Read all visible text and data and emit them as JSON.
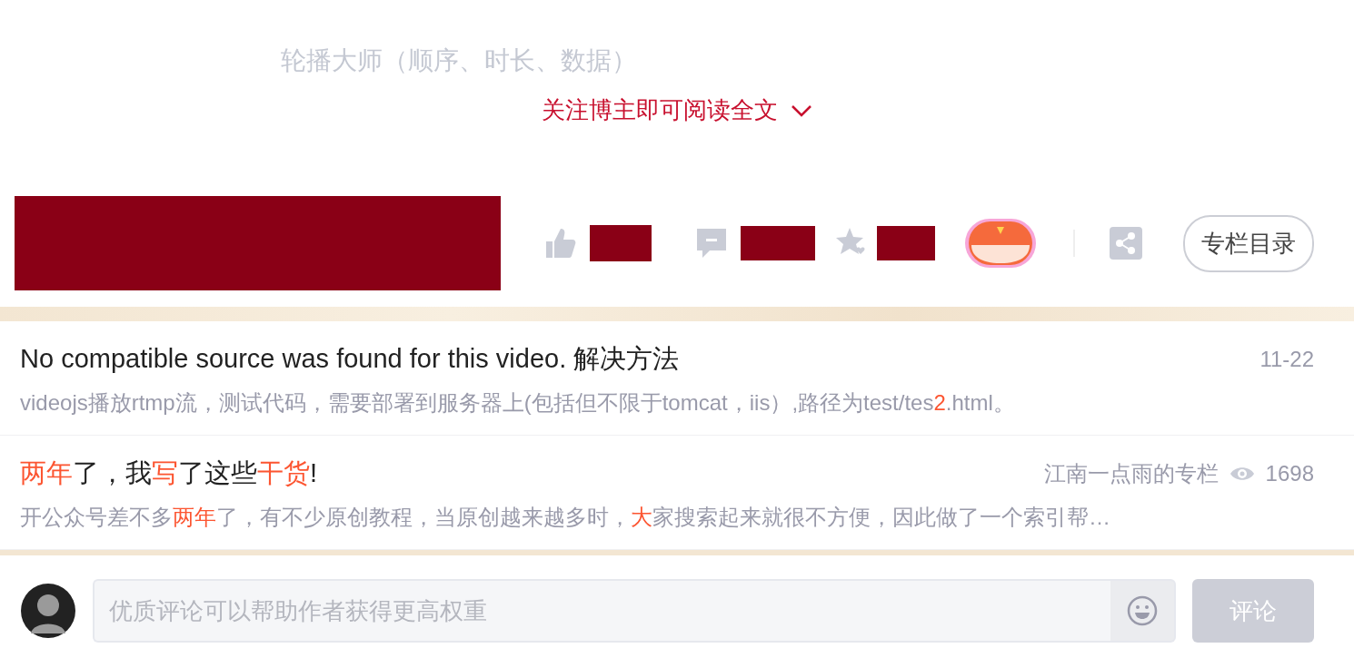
{
  "faded_title": "轮播大师（顺序、时长、数据）",
  "read_more": {
    "label": "关注博主即可阅读全文"
  },
  "toolbar": {
    "column_button": "专栏目录"
  },
  "recommendations": [
    {
      "kind": "plain",
      "title": [
        {
          "text": "No compatible source was found for this video. 解决方法",
          "highlight": false
        }
      ],
      "date": "11-22",
      "summary": [
        {
          "text": "videojs播放rtmp流，测试代码，需要部署到服务器上(包括但不限于tomcat，iis）,路径为test/tes",
          "highlight": false
        },
        {
          "text": "2",
          "highlight": true
        },
        {
          "text": ".html。",
          "highlight": false
        }
      ]
    },
    {
      "kind": "column",
      "title": [
        {
          "text": "两年",
          "highlight": true
        },
        {
          "text": "了，我",
          "highlight": false
        },
        {
          "text": "写",
          "highlight": true
        },
        {
          "text": "了这些",
          "highlight": false
        },
        {
          "text": "干货",
          "highlight": true
        },
        {
          "text": "!",
          "highlight": false
        }
      ],
      "source": "江南一点雨的专栏",
      "views": "1698",
      "summary": [
        {
          "text": "开公众号差不多",
          "highlight": false
        },
        {
          "text": "两年",
          "highlight": true
        },
        {
          "text": "了，有不少原创教程，当原创越来越多时，",
          "highlight": false
        },
        {
          "text": "大",
          "highlight": true
        },
        {
          "text": "家搜索起来就很不方便，因此做了一个索引帮…",
          "highlight": false
        }
      ]
    }
  ],
  "comment": {
    "placeholder": "优质评论可以帮助作者获得更高权重",
    "submit": "评论",
    "disabled": true
  }
}
